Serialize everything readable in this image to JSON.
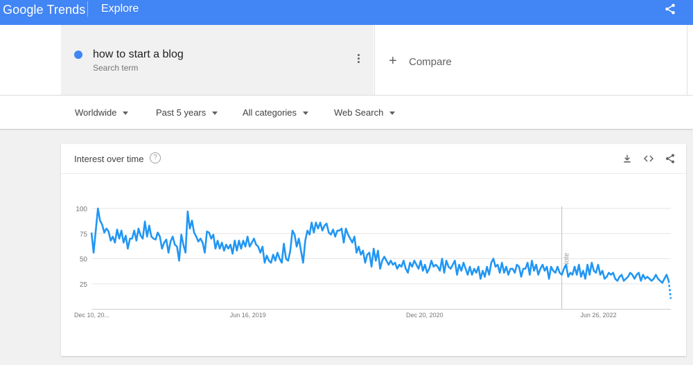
{
  "header": {
    "logo_google": "Google",
    "logo_trends": "Trends",
    "section": "Explore",
    "share_icon": "share-icon"
  },
  "search": {
    "term": "how to start a blog",
    "term_type": "Search term",
    "term_color": "#4285f4",
    "menu_icon": "more-vert-icon",
    "compare_label": "Compare",
    "compare_icon": "plus-icon"
  },
  "filters": {
    "region": "Worldwide",
    "time_range": "Past 5 years",
    "category": "All categories",
    "search_type": "Web Search"
  },
  "card": {
    "title": "Interest over time",
    "help_icon": "help-icon",
    "actions": [
      "download-icon",
      "embed-icon",
      "share-icon"
    ]
  },
  "chart_data": {
    "type": "line",
    "title": "Interest over time",
    "x_tick_labels": [
      "Dec 10, 20...",
      "Jun 16, 2019",
      "Dec 20, 2020",
      "Jun 26, 2022"
    ],
    "y_ticks": [
      100,
      75,
      50,
      25
    ],
    "ylim": [
      0,
      100
    ],
    "grid": true,
    "line_color": "#2196f3",
    "annotation_label": "Note",
    "series": [
      {
        "values": [
          76,
          56,
          78,
          100,
          88,
          84,
          76,
          80,
          77,
          68,
          72,
          66,
          79,
          70,
          78,
          66,
          73,
          60,
          70,
          70,
          78,
          68,
          80,
          73,
          70,
          87,
          72,
          83,
          72,
          70,
          69,
          76,
          72,
          60,
          66,
          69,
          56,
          67,
          72,
          64,
          62,
          48,
          74,
          64,
          56,
          97,
          80,
          88,
          76,
          72,
          67,
          70,
          66,
          56,
          77,
          76,
          70,
          74,
          60,
          68,
          60,
          66,
          58,
          64,
          60,
          64,
          55,
          68,
          58,
          68,
          60,
          68,
          62,
          72,
          62,
          66,
          70,
          64,
          62,
          56,
          62,
          46,
          53,
          48,
          46,
          54,
          48,
          56,
          50,
          46,
          65,
          50,
          48,
          58,
          78,
          74,
          62,
          70,
          58,
          46,
          68,
          78,
          74,
          86,
          76,
          86,
          80,
          86,
          78,
          83,
          85,
          76,
          74,
          79,
          72,
          78,
          78,
          80,
          66,
          80,
          74,
          70,
          66,
          72,
          56,
          62,
          54,
          58,
          46,
          54,
          56,
          42,
          60,
          48,
          58,
          40,
          48,
          52,
          48,
          44,
          48,
          44,
          46,
          40,
          44,
          42,
          48,
          40,
          36,
          46,
          42,
          48,
          44,
          40,
          48,
          38,
          44,
          36,
          40,
          48,
          42,
          44,
          42,
          38,
          50,
          36,
          48,
          42,
          40,
          44,
          48,
          34,
          44,
          38,
          46,
          40,
          34,
          42,
          34,
          40,
          36,
          42,
          30,
          38,
          32,
          42,
          34,
          46,
          50,
          42,
          44,
          36,
          46,
          36,
          42,
          34,
          40,
          40,
          36,
          44,
          42,
          32,
          40,
          40,
          46,
          34,
          48,
          38,
          44,
          34,
          40,
          44,
          38,
          42,
          30,
          42,
          38,
          36,
          42,
          36,
          34,
          40,
          44,
          32,
          36,
          34,
          42,
          34,
          44,
          32,
          38,
          30,
          44,
          34,
          46,
          38,
          36,
          44,
          34,
          38,
          30,
          32,
          36,
          34,
          36,
          30,
          28,
          32,
          34,
          28,
          30,
          32,
          36,
          34,
          30,
          34,
          36,
          28,
          34,
          30,
          32,
          30,
          28,
          30,
          34,
          30,
          28,
          26,
          30,
          34,
          28,
          10
        ]
      }
    ]
  }
}
